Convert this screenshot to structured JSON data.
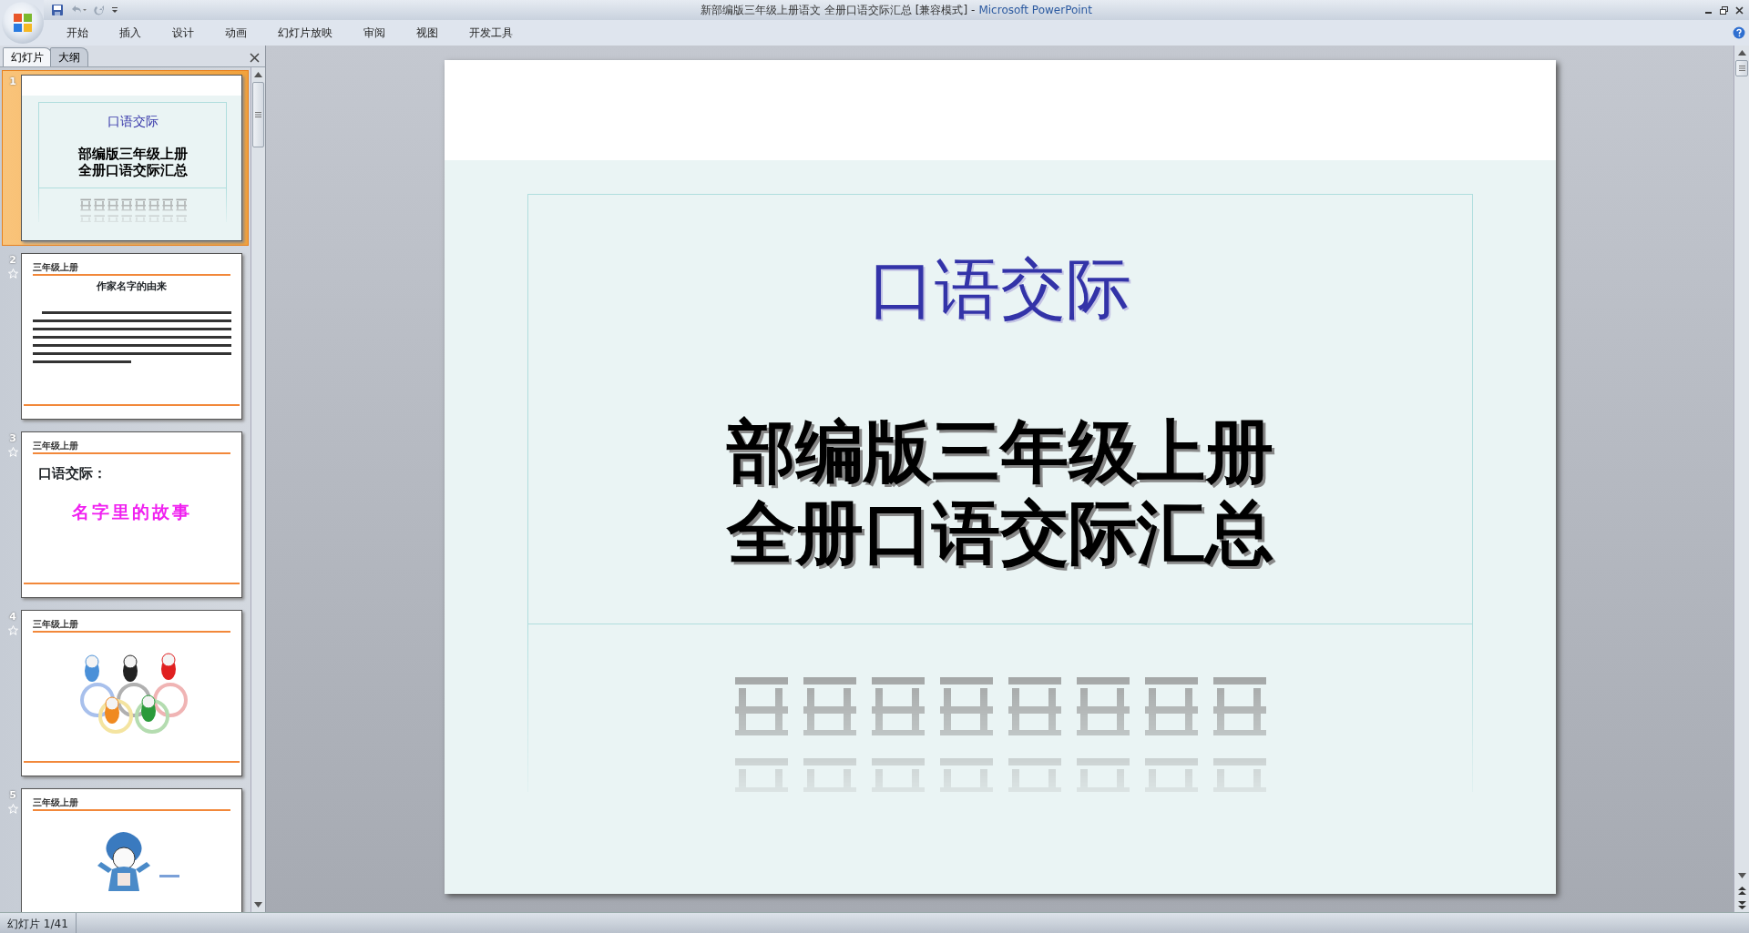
{
  "window": {
    "document_title": "新部编版三年级上册语文 全册口语交际汇总 [兼容模式]",
    "separator": "-",
    "app_name": "Microsoft PowerPoint"
  },
  "ribbon_tabs": [
    {
      "label": "开始",
      "selected": false
    },
    {
      "label": "插入",
      "selected": false
    },
    {
      "label": "设计",
      "selected": false
    },
    {
      "label": "动画",
      "selected": false
    },
    {
      "label": "幻灯片放映",
      "selected": false
    },
    {
      "label": "审阅",
      "selected": false
    },
    {
      "label": "视图",
      "selected": false
    },
    {
      "label": "开发工具",
      "selected": false
    }
  ],
  "panel_tabs": [
    {
      "label": "幻灯片",
      "selected": true
    },
    {
      "label": "大纲",
      "selected": false
    }
  ],
  "slides": [
    {
      "number": "1",
      "selected": true,
      "animated": false,
      "kind": "title",
      "title": "口语交际",
      "subtitle_lines": [
        "部编版三年级上册",
        "全册口语交际汇总"
      ]
    },
    {
      "number": "2",
      "selected": false,
      "animated": true,
      "kind": "text",
      "header": "三年级上册",
      "title": "作家名字的由来"
    },
    {
      "number": "3",
      "selected": false,
      "animated": true,
      "kind": "heading",
      "header": "三年级上册",
      "heading": "口语交际：",
      "title": "名字里的故事"
    },
    {
      "number": "4",
      "selected": false,
      "animated": true,
      "kind": "rings",
      "header": "三年级上册"
    },
    {
      "number": "5",
      "selected": false,
      "animated": true,
      "kind": "figure",
      "header": "三年级上册"
    }
  ],
  "main_slide": {
    "title": "口语交际",
    "subtitle_lines": [
      "部编版三年级上册",
      "全册口语交际汇总"
    ]
  },
  "status_bar": {
    "slide_indicator": "幻灯片 1/41"
  }
}
